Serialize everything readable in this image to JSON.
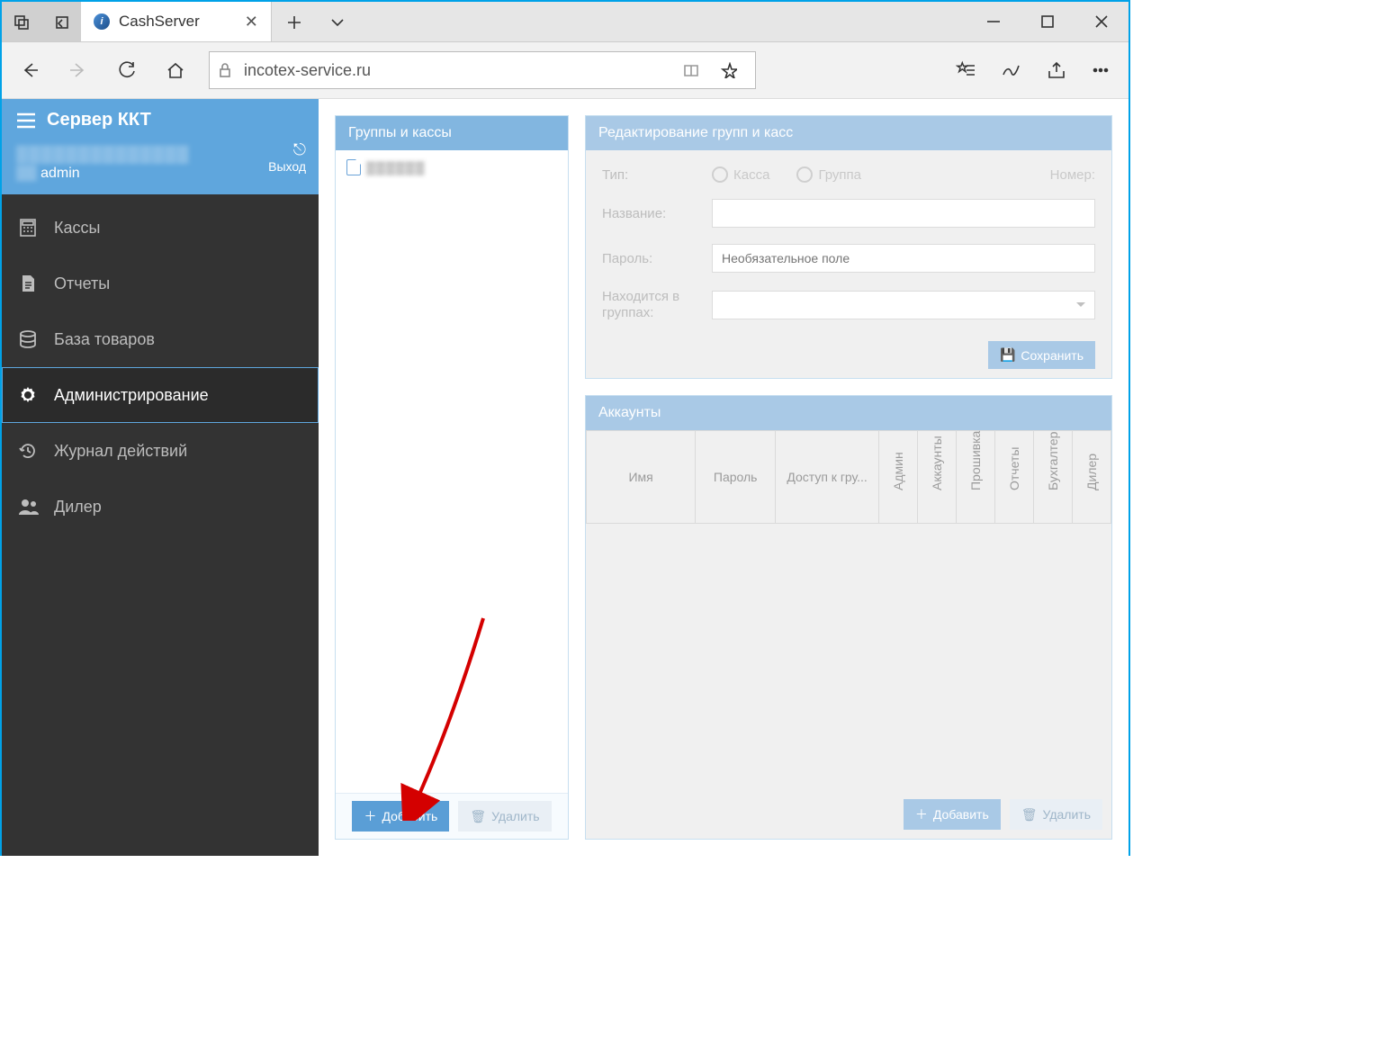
{
  "browser": {
    "tab_title": "CashServer",
    "url": "incotex-service.ru"
  },
  "sidebar": {
    "title": "Сервер ККТ",
    "user_name_masked": "▒▒▒▒▒▒▒▒▒▒▒▒▒▒",
    "admin_label": "admin",
    "logout": "Выход",
    "items": [
      {
        "label": "Кассы"
      },
      {
        "label": "Отчеты"
      },
      {
        "label": "База товаров"
      },
      {
        "label": "Администрирование"
      },
      {
        "label": "Журнал действий"
      },
      {
        "label": "Дилер"
      }
    ],
    "active_index": 3
  },
  "groups_panel": {
    "title": "Группы и кассы",
    "root_item_masked": "▒▒▒▒▒▒",
    "add_label": "Добавить",
    "delete_label": "Удалить"
  },
  "edit_panel": {
    "title": "Редактирование групп и касс",
    "fields": {
      "type_label": "Тип:",
      "type_option_kassa": "Касса",
      "type_option_group": "Группа",
      "number_label": "Номер:",
      "name_label": "Название:",
      "password_label": "Пароль:",
      "password_placeholder": "Необязательное поле",
      "in_groups_label_line1": "Находится в",
      "in_groups_label_line2": "группах:"
    },
    "save_label": "Сохранить"
  },
  "accounts_panel": {
    "title": "Аккаунты",
    "columns": {
      "name": "Имя",
      "password": "Пароль",
      "access": "Доступ к гру...",
      "admin": "Админ",
      "accounts": "Аккаунты",
      "firmware": "Прошивка",
      "reports": "Отчеты",
      "accountant": "Бухгалтер",
      "dealer": "Дилер"
    },
    "add_label": "Добавить",
    "delete_label": "Удалить"
  }
}
